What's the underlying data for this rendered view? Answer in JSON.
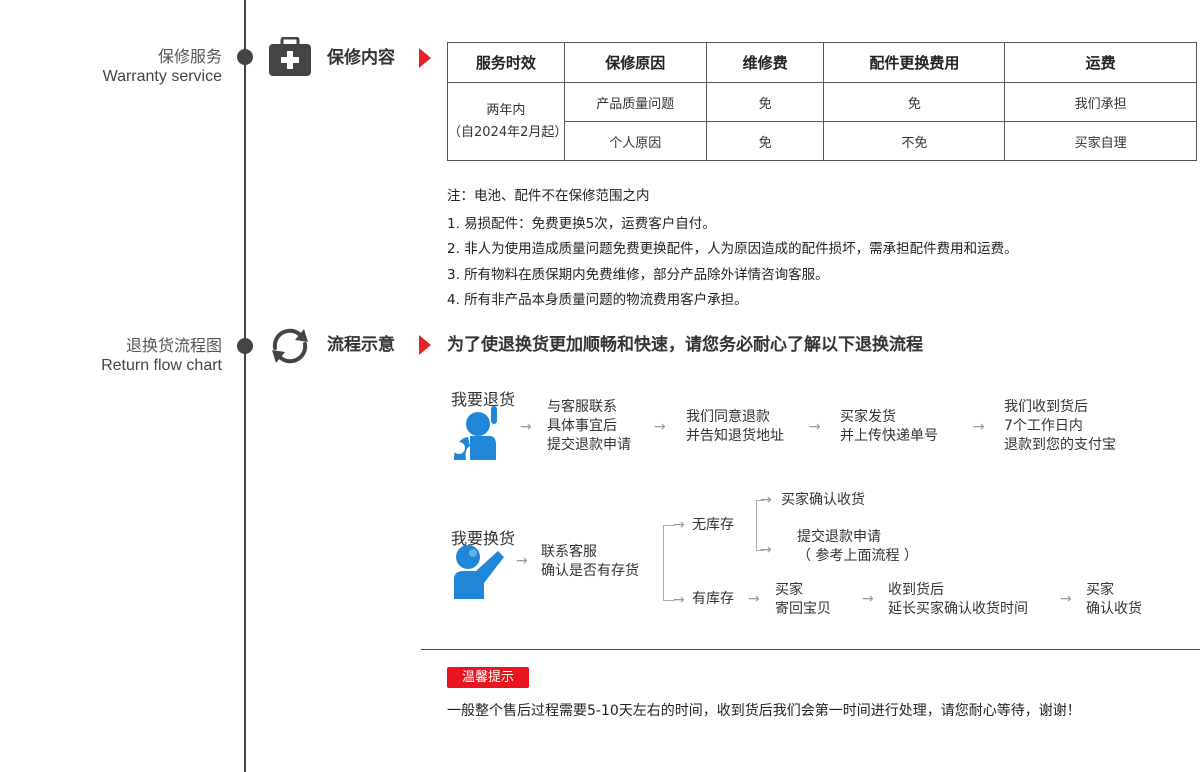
{
  "warranty": {
    "label_zh": "保修服务",
    "label_en": "Warranty service",
    "title": "保修内容",
    "table": {
      "headers": [
        "服务时效",
        "保修原因",
        "维修费",
        "配件更换费用",
        "运费"
      ],
      "period_line1": "两年内",
      "period_line2": "（自2024年2月起）",
      "rows": [
        [
          "产品质量问题",
          "免",
          "免",
          "我们承担"
        ],
        [
          "个人原因",
          "免",
          "不免",
          "买家自理"
        ]
      ]
    },
    "notes": {
      "head": "注：电池、配件不在保修范围之内",
      "items": [
        "1. 易损配件：免费更换5次，运费客户自付。",
        "2. 非人为使用造成质量问题免费更换配件，人为原因造成的配件损坏，需承担配件费用和运费。",
        "3. 所有物料在质保期内免费维修，部分产品除外详情咨询客服。",
        "4. 所有非产品本身质量问题的物流费用客户承担。"
      ]
    }
  },
  "returns": {
    "label_zh": "退换货流程图",
    "label_en": "Return flow chart",
    "title": "流程示意",
    "heading": "为了使退换货更加顺畅和快速，请您务必耐心了解以下退换流程",
    "refund": {
      "persona": "我要退货",
      "steps": [
        [
          "与客服联系",
          "具体事宜后",
          "提交退款申请"
        ],
        [
          "我们同意退款",
          "并告知退货地址"
        ],
        [
          "买家发货",
          "并上传快递单号"
        ],
        [
          "我们收到货后",
          "7个工作日内",
          "退款到您的支付宝"
        ]
      ]
    },
    "exchange": {
      "persona": "我要换货",
      "first": [
        "联系客服",
        "确认是否有存货"
      ],
      "no_stock": "无库存",
      "no_stock_a": "买家确认收货",
      "no_stock_b1": "提交退款申请",
      "no_stock_b2": "（ 参考上面流程 ）",
      "in_stock": "有库存",
      "in_stock_steps": [
        [
          "买家",
          "寄回宝贝"
        ],
        [
          "收到货后",
          "延长买家确认收货时间"
        ],
        [
          "买家",
          "确认收货"
        ]
      ]
    },
    "arrow": "→"
  },
  "tip": {
    "badge": "温馨提示",
    "text": "一般整个售后过程需要5-10天左右的时间，收到货后我们会第一时间进行处理，请您耐心等待，谢谢！"
  },
  "colors": {
    "accent_red": "#e8202a",
    "persona_blue": "#1f86d8",
    "timeline": "#444444"
  }
}
